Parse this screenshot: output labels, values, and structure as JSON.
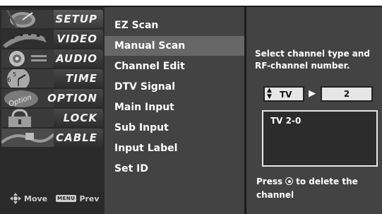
{
  "sidebar": {
    "categories": [
      {
        "label": "SETUP",
        "icon": "satellite-dish-icon"
      },
      {
        "label": "VIDEO",
        "icon": "film-reel-icon"
      },
      {
        "label": "AUDIO",
        "icon": "speaker-icon"
      },
      {
        "label": "TIME",
        "icon": "clock-icon"
      },
      {
        "label": "OPTION",
        "icon": "option-icon"
      },
      {
        "label": "LOCK",
        "icon": "padlock-icon"
      },
      {
        "label": "CABLE",
        "icon": "cable-icon"
      }
    ],
    "active_category": "SETUP",
    "nav_hint": {
      "move_label": "Move",
      "menu_key": "MENU",
      "prev_label": "Prev"
    }
  },
  "menu": {
    "items": [
      "EZ Scan",
      "Manual Scan",
      "Channel Edit",
      "DTV Signal",
      "Main Input",
      "Sub Input",
      "Input Label",
      "Set ID"
    ],
    "selected": "Manual Scan"
  },
  "panel": {
    "instruction": "Select channel type and RF-channel number.",
    "channel_type": "TV",
    "rf_channel": "2",
    "result": "TV 2-0",
    "press_prefix": "Press",
    "press_suffix": "to delete the channel"
  },
  "colors": {
    "osd_background": "#1c1c1c",
    "menu_background": "#434343",
    "selected_item": "#676767",
    "value_box": "#e6e6e6"
  }
}
